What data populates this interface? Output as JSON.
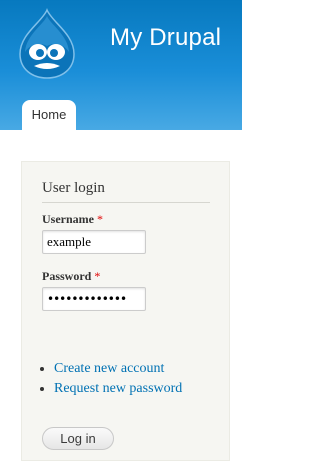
{
  "header": {
    "site_name": "My Drupal",
    "logo_icon": "drupal-drop-icon",
    "gradient_colors": [
      "#0779bf",
      "#48a9e4"
    ]
  },
  "nav": {
    "tabs": [
      {
        "label": "Home",
        "active": true
      }
    ]
  },
  "login_block": {
    "title": "User login",
    "username": {
      "label": "Username",
      "required_marker": "*",
      "value": "example"
    },
    "password": {
      "label": "Password",
      "required_marker": "*",
      "masked_value": "•••••••••••••"
    },
    "links": [
      {
        "label": "Create new account"
      },
      {
        "label": "Request new password"
      }
    ],
    "submit_label": "Log in",
    "link_color": "#0071b3",
    "required_color": "#e00000"
  }
}
